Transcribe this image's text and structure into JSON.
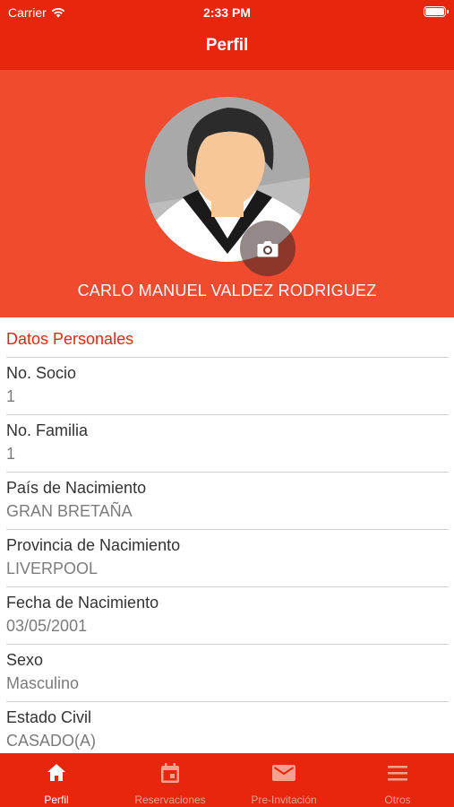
{
  "status_bar": {
    "carrier": "Carrier",
    "time": "2:33 PM"
  },
  "nav": {
    "title": "Perfil"
  },
  "profile": {
    "full_name": "CARLO MANUEL VALDEZ RODRIGUEZ",
    "camera_icon": "camera-icon"
  },
  "section": {
    "title": "Datos Personales"
  },
  "fields": [
    {
      "label": "No. Socio",
      "value": "1"
    },
    {
      "label": "No. Familia",
      "value": "1"
    },
    {
      "label": "País de Nacimiento",
      "value": "GRAN BRETAÑA"
    },
    {
      "label": "Provincia de Nacimiento",
      "value": "LIVERPOOL"
    },
    {
      "label": "Fecha de Nacimiento",
      "value": "03/05/2001"
    },
    {
      "label": "Sexo",
      "value": "Masculino"
    },
    {
      "label": "Estado Civil",
      "value": "CASADO(A)"
    }
  ],
  "tabs": [
    {
      "label": "Perfil",
      "icon": "home-icon",
      "active": true
    },
    {
      "label": "Reservaciones",
      "icon": "calendar-icon",
      "active": false
    },
    {
      "label": "Pre-Invitación",
      "icon": "envelope-icon",
      "active": false
    },
    {
      "label": "Otros",
      "icon": "menu-icon",
      "active": false
    }
  ],
  "colors": {
    "primary": "#e8260e",
    "hero": "#f04b2e",
    "value_text": "#7b7b7b"
  }
}
